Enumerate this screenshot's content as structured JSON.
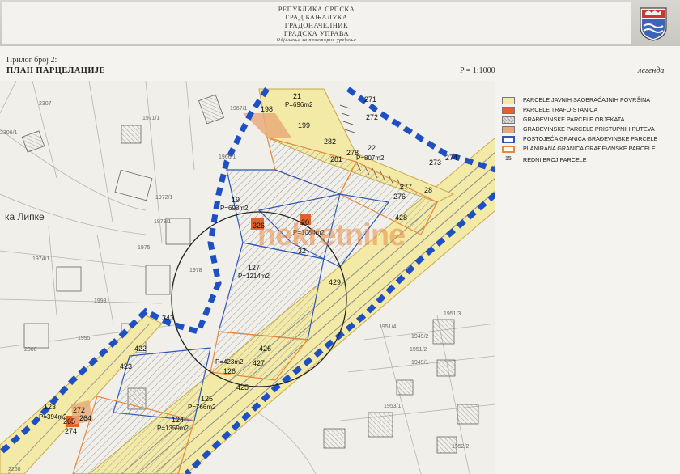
{
  "header": {
    "lines": [
      "РЕПУБЛИКА СРПСКА",
      "ГРАД БАЊАЛУКА",
      "ГРАДОНАЧЕЛНИК",
      "ГРАДСКА УПРАВА"
    ],
    "department": "Одјељење за просторно уређење"
  },
  "document": {
    "attachment": "Прилог број 2:",
    "title": "ПЛАН ПАРЦЕЛАЦИЈЕ",
    "scale": "P = 1:1000",
    "legend_heading": "легенда"
  },
  "legend": {
    "items": [
      {
        "label": "PARCELE JAVNIH SAOBRAĆAJNIH POVRŠINA",
        "color": "#f2eaa6",
        "style": "fill"
      },
      {
        "label": "PARCELE TRAFO-STANICA",
        "color": "#e2622a",
        "style": "fill"
      },
      {
        "label": "GRAĐEVINSKE PARCELE OBJEKATA",
        "color": "#cfcfcf",
        "style": "hatch"
      },
      {
        "label": "GRAĐEVINSKE PARCELE PRISTUPNIH PUTEVA",
        "color": "#e9a777",
        "style": "fill"
      },
      {
        "label": "POSTOJEĆA GRANICA GRAĐEVINSKE PARCELE",
        "color": "#2c56b8",
        "style": "line"
      },
      {
        "label": "PLANIRANA GRANICA GRAĐEVINSKE PARCELE",
        "color": "#e8883a",
        "style": "line"
      },
      {
        "label": "REDNI BROJ PARCELE",
        "color": "#333333",
        "style": "number",
        "sample": "15"
      }
    ]
  },
  "map": {
    "street_name": "ка Липке",
    "watermark": "nekretnine",
    "parcel_numbers": [
      "21",
      "199",
      "198",
      "271",
      "272",
      "273",
      "274",
      "22",
      "278",
      "281",
      "282",
      "277",
      "276",
      "28",
      "428",
      "19",
      "326",
      "20",
      "32",
      "127",
      "429",
      "426",
      "427",
      "425",
      "126",
      "125",
      "124",
      "343",
      "422",
      "423",
      "123",
      "272",
      "265",
      "264",
      "274"
    ],
    "areas": [
      "P=696m2",
      "P=807m2",
      "P=698m2",
      "P=1084m2",
      "P=1214m2",
      "P=423m2",
      "P=766m2",
      "P=1359m2",
      "P=394m2"
    ],
    "cadastral_numbers": [
      "2307",
      "1967/1",
      "1971/1",
      "2306/1",
      "1966/1",
      "1972/1",
      "1973/1",
      "1975",
      "1974/1",
      "1978",
      "1993",
      "1995",
      "2000",
      "1951/3",
      "1951/4",
      "1949/2",
      "1951/2",
      "1949/1",
      "1953/1",
      "1952/2",
      "2268"
    ]
  },
  "colors": {
    "road_fill": "#f2eaa6",
    "trafo": "#e2622a",
    "access_path": "#e9a777",
    "existing_border": "#2c56b8",
    "planned_border": "#e8883a",
    "dashed_boundary": "#1f4fc4"
  }
}
